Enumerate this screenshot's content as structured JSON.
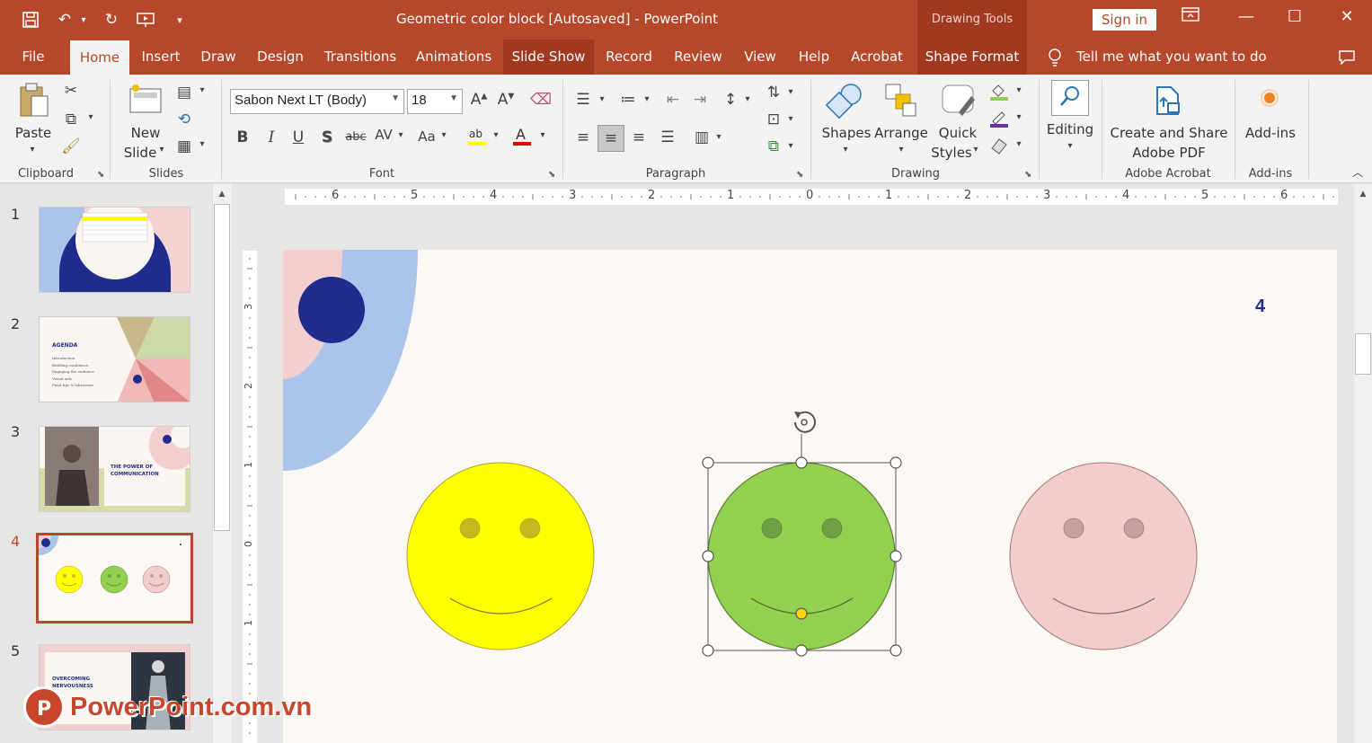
{
  "window": {
    "title": "Geometric color block [Autosaved]  -  PowerPoint",
    "contextual_group": "Drawing Tools",
    "sign_in": "Sign in"
  },
  "tabs": [
    "File",
    "Home",
    "Insert",
    "Draw",
    "Design",
    "Transitions",
    "Animations",
    "Slide Show",
    "Record",
    "Review",
    "View",
    "Help",
    "Acrobat",
    "Shape Format"
  ],
  "active_tab": "Home",
  "tell_me": "Tell me what you want to do",
  "ribbon": {
    "clipboard": {
      "label": "Clipboard",
      "paste": "Paste"
    },
    "slides": {
      "label": "Slides",
      "new_slide_1": "New",
      "new_slide_2": "Slide"
    },
    "font": {
      "label": "Font",
      "font_name": "Sabon Next LT (Body)",
      "font_size": "18"
    },
    "paragraph": {
      "label": "Paragraph"
    },
    "drawing": {
      "label": "Drawing",
      "shapes": "Shapes",
      "arrange": "Arrange",
      "quick_1": "Quick",
      "quick_2": "Styles"
    },
    "editing": {
      "label": "Editing"
    },
    "acrobat": {
      "label": "Adobe Acrobat",
      "btn_1": "Create and Share",
      "btn_2": "Adobe PDF"
    },
    "addins": {
      "label": "Add-ins",
      "btn": "Add-ins"
    }
  },
  "thumbnails": {
    "numbers": [
      "1",
      "2",
      "3",
      "4",
      "5"
    ],
    "selected": "4",
    "slide2_title": "AGENDA",
    "slide2_items": [
      "Introduction",
      "Building confidence",
      "Engaging the audience",
      "Visual aids",
      "Final tips & takeaways"
    ],
    "slide3_title_1": "THE POWER OF",
    "slide3_title_2": "COMMUNICATION",
    "slide5_title_1": "OVERCOMING",
    "slide5_title_2": "NERVOUSNESS"
  },
  "ruler": {
    "horizontal": [
      "6",
      "5",
      "4",
      "3",
      "2",
      "1",
      "0",
      "1",
      "2",
      "3",
      "4",
      "5",
      "6"
    ],
    "vertical": [
      "3",
      "2",
      "1",
      "0",
      "1"
    ]
  },
  "slide": {
    "page_number": "4",
    "faces": [
      {
        "name": "yellow",
        "fill": "#ffff00",
        "eyes": "#c8b820",
        "stroke": "#b0a030"
      },
      {
        "name": "green",
        "fill": "#92d050",
        "eyes": "#6e9f45",
        "stroke": "#5d7f3c",
        "selected": true
      },
      {
        "name": "pink",
        "fill": "#f4cccc",
        "eyes": "#c4a0a0",
        "stroke": "#9b7b7b"
      }
    ]
  },
  "watermark": "PowerPoint.com.vn",
  "colors": {
    "accent": "#b7472a",
    "navy": "#1f2c8b",
    "light_blue": "#aac4ea",
    "pink": "#f4cfcf"
  }
}
